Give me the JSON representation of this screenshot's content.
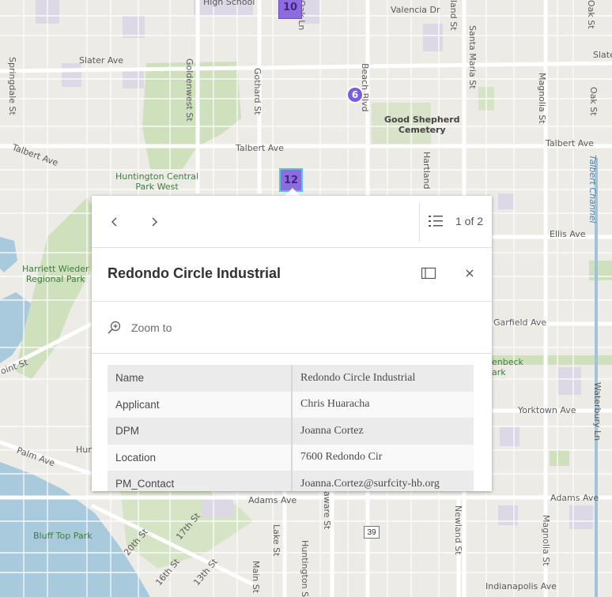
{
  "map": {
    "labels": {
      "high_school": "High School",
      "valencia": "Valencia Dr",
      "slater": "Slater Ave",
      "slater_e": "Slate",
      "springdale": "Springdale St",
      "goldenwest": "Goldenwest St",
      "gothard": "Gothard St",
      "beach": "Beach Blvd",
      "santa_maria": "Santa Maria St",
      "magnolia": "Magnolia St",
      "oak_top": "Oak St",
      "oak2": "Oak St",
      "oak_ln": "Oak Ln",
      "land_st": "land St",
      "good_shepherd": "Good Shepherd\nCemetery",
      "talbert_w": "Talbert Ave",
      "talbert_mid": "Talbert Ave",
      "talbert_e": "Talbert Ave",
      "talbert_channel": "Talbert Channel",
      "hartland": "Hartland",
      "hcp_west": "Huntington Central\nPark West",
      "harriett": "Harriett Wieder\nRegional Park",
      "ellis": "Ellis Ave",
      "garfield": "Garfield Ave",
      "enbeck": "enbeck\nark",
      "yorktown": "Yorktown Ave",
      "waterbury": "Waterbury Ln",
      "point_st": "oint St",
      "palm": "Palm Ave",
      "hun": "Hun",
      "adams_w": "Adams Ave",
      "adams_e": "Adams Ave",
      "aware": "aware St",
      "newland": "Newland St",
      "magnolia_s": "Magnolia St",
      "bluff": "Bluff Top Park",
      "st20": "20th St",
      "st17": "17th St",
      "st16": "16th St",
      "st13": "13th St",
      "lake": "Lake St",
      "main": "Main St",
      "huntington": "Huntington St",
      "indianapolis": "Indianapolis Ave",
      "route39": "39"
    },
    "markers": {
      "m10": "10",
      "m6": "6",
      "m12": "12"
    }
  },
  "popup": {
    "prev_icon": "chevron-left-icon",
    "next_icon": "chevron-right-icon",
    "pager": "1 of 2",
    "title": "Redondo Circle Industrial",
    "zoom_label": "Zoom to",
    "fields": [
      {
        "key": "Name",
        "value": "Redondo Circle Industrial"
      },
      {
        "key": "Applicant",
        "value": "Chris Huaracha"
      },
      {
        "key": "DPM",
        "value": "Joanna Cortez"
      },
      {
        "key": "Location",
        "value": "7600 Redondo Cir"
      },
      {
        "key": "PM_Contact",
        "value": "Joanna.Cortez@surfcity-hb.org"
      }
    ]
  }
}
